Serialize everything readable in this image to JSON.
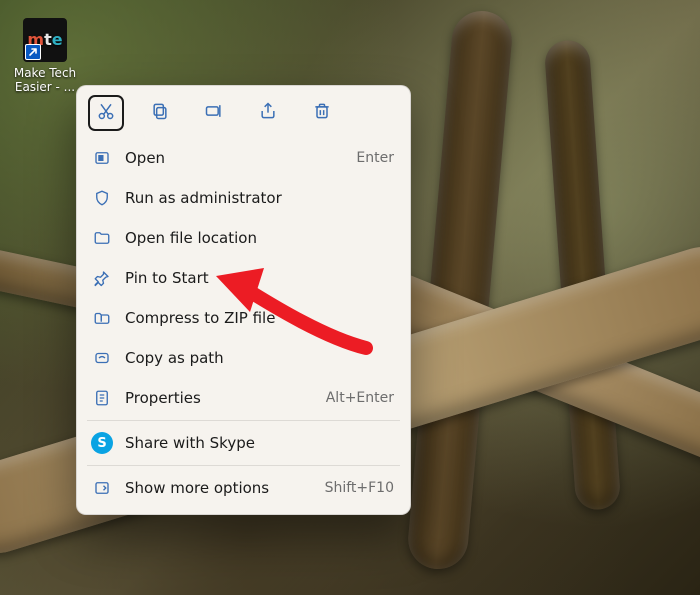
{
  "desktop_icon": {
    "label": "Make Tech Easier - ...",
    "tile_letters": {
      "m": "m",
      "t": "t",
      "e": "e"
    }
  },
  "context_menu": {
    "toolbar": {
      "cut": {
        "name": "cut-icon"
      },
      "copy": {
        "name": "copy-icon"
      },
      "rename": {
        "name": "rename-icon"
      },
      "share": {
        "name": "share-icon"
      },
      "delete": {
        "name": "delete-icon"
      }
    },
    "items": [
      {
        "icon": "open-icon",
        "label": "Open",
        "shortcut": "Enter"
      },
      {
        "icon": "shield-icon",
        "label": "Run as administrator",
        "shortcut": ""
      },
      {
        "icon": "folder-icon",
        "label": "Open file location",
        "shortcut": ""
      },
      {
        "icon": "pin-icon",
        "label": "Pin to Start",
        "shortcut": ""
      },
      {
        "icon": "zip-icon",
        "label": "Compress to ZIP file",
        "shortcut": ""
      },
      {
        "icon": "copy-path-icon",
        "label": "Copy as path",
        "shortcut": ""
      },
      {
        "icon": "properties-icon",
        "label": "Properties",
        "shortcut": "Alt+Enter"
      }
    ],
    "items2": [
      {
        "icon": "skype-icon",
        "label": "Share with Skype",
        "shortcut": ""
      }
    ],
    "items3": [
      {
        "icon": "more-options-icon",
        "label": "Show more options",
        "shortcut": "Shift+F10"
      }
    ]
  },
  "annotation": {
    "points_to_item_index": 3
  },
  "colors": {
    "menu_bg": "#f6f3ee",
    "menu_text": "#1b1b1b",
    "icon_blue": "#3b6fb5",
    "skype_blue": "#0aa3e3",
    "arrow_red": "#ec1c24"
  }
}
